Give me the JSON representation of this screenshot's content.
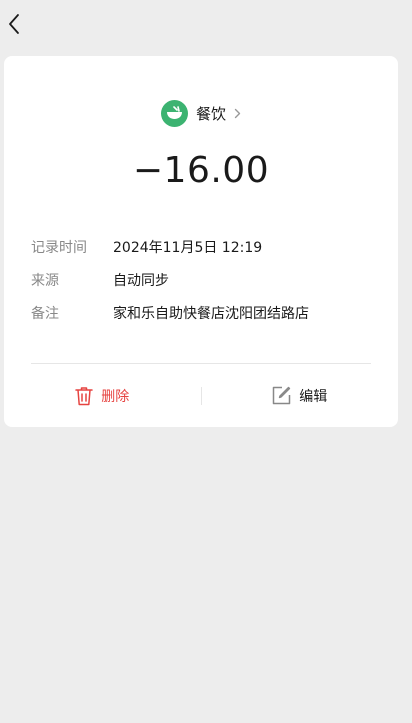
{
  "nav": {
    "back_icon": "chevron-left-icon"
  },
  "category": {
    "name": "餐饮",
    "icon": "bowl-icon",
    "icon_bg": "#3cb371"
  },
  "amount": "−16.00",
  "details": [
    {
      "label": "记录时间",
      "value": "2024年11月5日 12:19"
    },
    {
      "label": "来源",
      "value": "自动同步"
    },
    {
      "label": "备注",
      "value": "家和乐自助快餐店沈阳团结路店"
    }
  ],
  "actions": {
    "delete_label": "删除",
    "delete_icon": "trash-icon",
    "delete_color": "#e64340",
    "edit_label": "编辑",
    "edit_icon": "edit-icon"
  }
}
